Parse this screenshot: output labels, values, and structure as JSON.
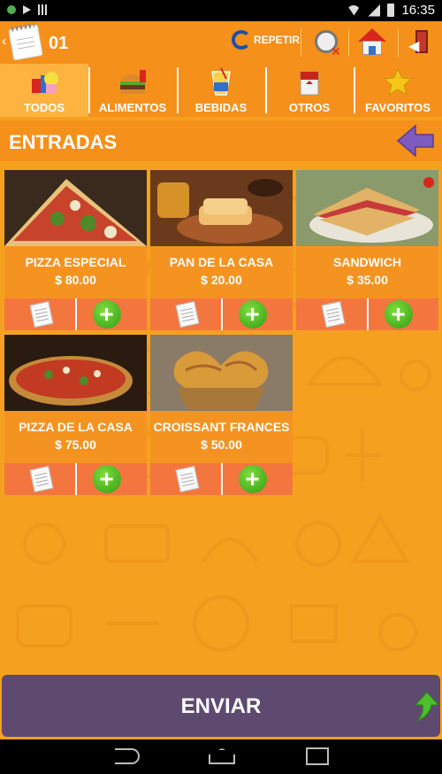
{
  "status_bar": {
    "time": "16:35"
  },
  "header": {
    "order_number": "01",
    "repeat_label": "REPETIR"
  },
  "tabs": [
    {
      "label": "TODOS",
      "active": true
    },
    {
      "label": "ALIMENTOS",
      "active": false
    },
    {
      "label": "BEBIDAS",
      "active": false
    },
    {
      "label": "OTROS",
      "active": false
    },
    {
      "label": "FAVORITOS",
      "active": false
    }
  ],
  "section": {
    "title": "ENTRADAS"
  },
  "products": [
    {
      "name": "PIZZA ESPECIAL",
      "price": "$ 80.00"
    },
    {
      "name": "PAN DE LA CASA",
      "price": "$ 20.00"
    },
    {
      "name": "SANDWICH",
      "price": "$ 35.00"
    },
    {
      "name": "PIZZA DE LA CASA",
      "price": "$ 75.00"
    },
    {
      "name": "CROISSANT FRANCES",
      "price": "$ 50.00"
    }
  ],
  "actions": {
    "add_symbol": "+"
  },
  "send_button": {
    "label": "ENVIAR"
  },
  "colors": {
    "header": "#f5901b",
    "active_tab": "#fcb33f",
    "background": "#f5a11f",
    "action_bar": "#f4763f",
    "send_button": "#5d4a6e",
    "add_green": "#2f9e12"
  }
}
